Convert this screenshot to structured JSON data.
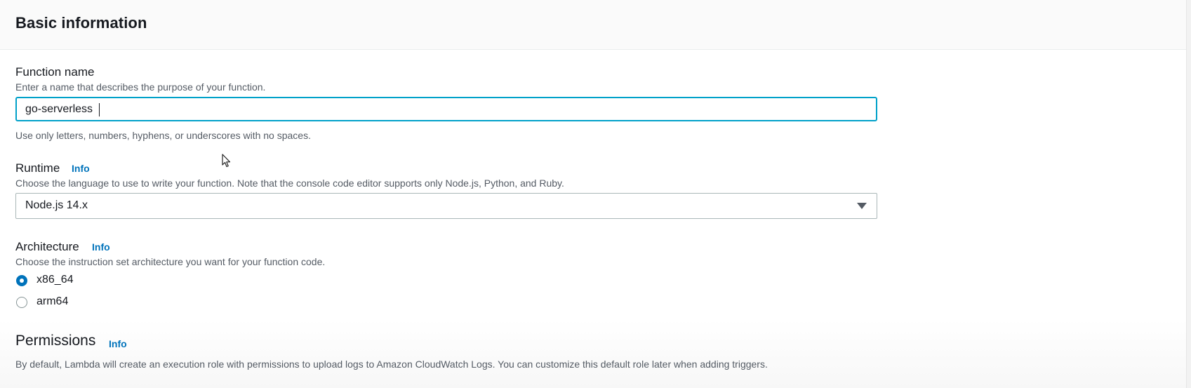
{
  "panel": {
    "title": "Basic information"
  },
  "function_name": {
    "label": "Function name",
    "description": "Enter a name that describes the purpose of your function.",
    "value": "go-serverless",
    "constraint": "Use only letters, numbers, hyphens, or underscores with no spaces."
  },
  "runtime": {
    "label": "Runtime",
    "info": "Info",
    "description": "Choose the language to use to write your function. Note that the console code editor supports only Node.js, Python, and Ruby.",
    "selected": "Node.js 14.x"
  },
  "architecture": {
    "label": "Architecture",
    "info": "Info",
    "description": "Choose the instruction set architecture you want for your function code.",
    "options": [
      {
        "label": "x86_64",
        "checked": true
      },
      {
        "label": "arm64",
        "checked": false
      }
    ]
  },
  "permissions": {
    "title": "Permissions",
    "info": "Info",
    "description": "By default, Lambda will create an execution role with permissions to upload logs to Amazon CloudWatch Logs. You can customize this default role later when adding triggers."
  },
  "colors": {
    "accent": "#0073bb",
    "focus": "#00a1c9",
    "text": "#16191f",
    "muted": "#545b64"
  }
}
